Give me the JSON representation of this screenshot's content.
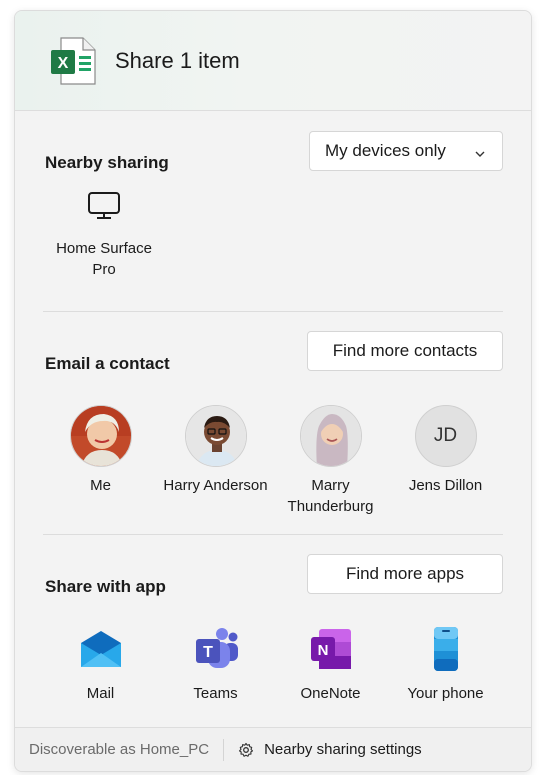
{
  "header": {
    "file_icon": "excel-file-icon",
    "title": "Share 1 item"
  },
  "nearby": {
    "title": "Nearby sharing",
    "dropdown_value": "My devices only",
    "devices": [
      {
        "name_line1": "Home Surface",
        "name_line2": "Pro",
        "icon": "monitor-icon"
      }
    ]
  },
  "email": {
    "title": "Email a contact",
    "button": "Find more contacts",
    "contacts": [
      {
        "name_line1": "Me",
        "name_line2": "",
        "avatar": "photo"
      },
      {
        "name_line1": "Harry Anderson",
        "name_line2": "",
        "avatar": "photo"
      },
      {
        "name_line1": "Marry",
        "name_line2": "Thunderburg",
        "avatar": "photo"
      },
      {
        "name_line1": "Jens Dillon",
        "name_line2": "",
        "avatar": "initials",
        "initials": "JD"
      }
    ]
  },
  "apps": {
    "title": "Share with app",
    "button": "Find more apps",
    "items": [
      {
        "name": "Mail",
        "icon": "mail-icon"
      },
      {
        "name": "Teams",
        "icon": "teams-icon"
      },
      {
        "name": "OneNote",
        "icon": "onenote-icon"
      },
      {
        "name": "Your phone",
        "icon": "phone-icon"
      }
    ]
  },
  "footer": {
    "status": "Discoverable as Home_PC",
    "settings_label": "Nearby sharing settings"
  },
  "colors": {
    "excel_green": "#1f7a45",
    "mail_blue": "#1382d8",
    "teams_purple": "#5b5fc7",
    "onenote_purple": "#7719aa",
    "phone_blue": "#1e90d6"
  }
}
